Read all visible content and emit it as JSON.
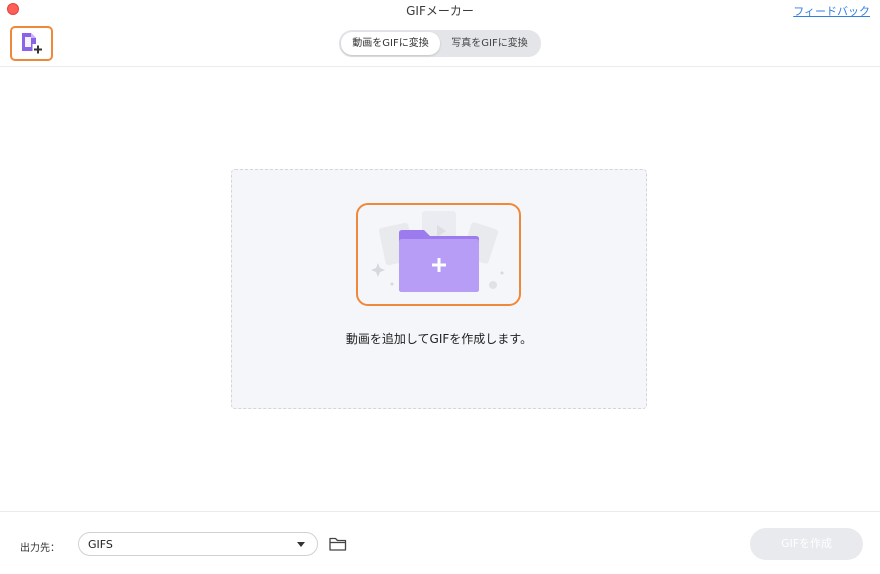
{
  "window": {
    "title": "GIFメーカー",
    "feedback_label": "フィードバック"
  },
  "toolbar": {
    "add_file_icon": "add-file-icon",
    "modes": [
      {
        "label": "動画をGIFに変換",
        "active": true
      },
      {
        "label": "写真をGIFに変換",
        "active": false
      }
    ]
  },
  "dropzone": {
    "icon": "add-folder-icon",
    "hint": "動画を追加してGIFを作成します。"
  },
  "footer": {
    "output_label": "出力先：",
    "output_value": "GIFS",
    "folder_icon": "folder-icon",
    "create_label": "GIFを作成"
  },
  "colors": {
    "accent_orange": "#f0883a",
    "folder_purple": "#a88bf0",
    "link_blue": "#2f7fe0"
  }
}
